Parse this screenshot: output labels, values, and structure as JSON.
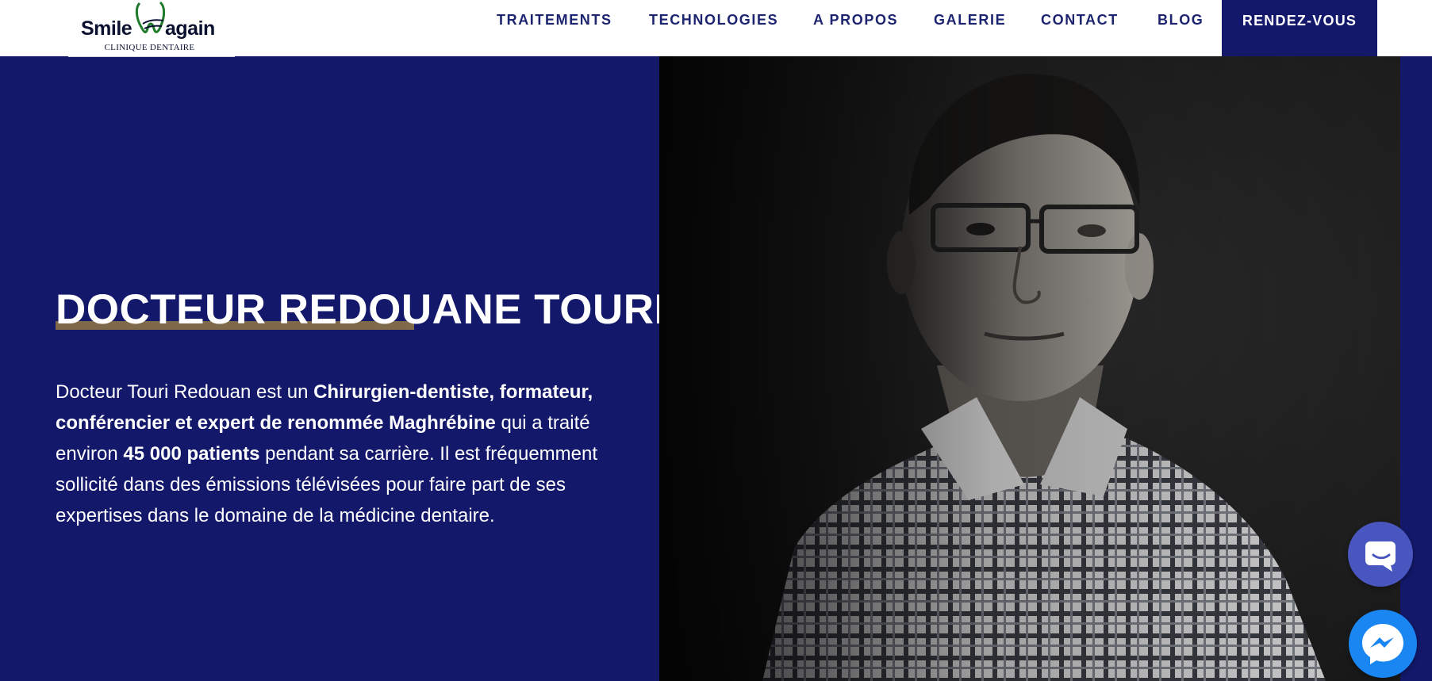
{
  "header": {
    "logo": {
      "word_left": "Smile",
      "word_right": "again",
      "subtitle": "CLINIQUE DENTAIRE"
    },
    "nav": [
      {
        "label": "TRAITEMENTS"
      },
      {
        "label": "TECHNOLOGIES"
      },
      {
        "label": "A PROPOS"
      },
      {
        "label": "GALERIE"
      },
      {
        "label": "CONTACT"
      },
      {
        "label": "BLOG"
      }
    ],
    "cta_label": "RENDEZ-VOUS"
  },
  "hero": {
    "title": "DOCTEUR REDOUANE TOURI",
    "description": {
      "p1": "Docteur Touri Redouan est un ",
      "b1": "Chirurgien-dentiste, formateur, conférencier et expert de renommée Maghrébine",
      "p2": " qui a traité environ ",
      "b2": "45 000 patients",
      "p3": " pendant sa carrière. Il est fréquemment sollicité dans des émissions télévisées pour faire part de ses expertises dans le domaine de la médicine dentaire."
    }
  },
  "floating": {
    "chat_icon": "chat-bubble-icon",
    "messenger_icon": "messenger-icon"
  },
  "colors": {
    "navy": "#13186a",
    "nav_text": "#1d2470",
    "underline": "#7e6a4a",
    "chat_button": "#4a56bf",
    "messenger_button": "#1a86f2"
  }
}
